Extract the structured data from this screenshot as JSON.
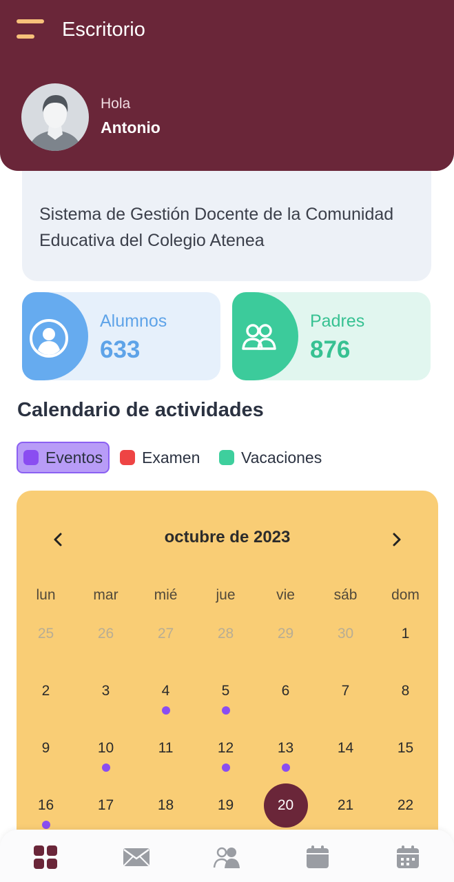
{
  "header": {
    "title": "Escritorio",
    "greeting": "Hola",
    "user_name": "Antonio",
    "background_color": "#6a2639",
    "menu_icon": "hamburger-menu-icon"
  },
  "intro": {
    "text": "Sistema de Gestión Docente de la Comunidad Educativa del Colegio Atenea"
  },
  "stats": [
    {
      "label": "Alumnos",
      "value": "633",
      "icon": "user-circle-icon",
      "color": "#66abef"
    },
    {
      "label": "Padres",
      "value": "876",
      "icon": "users-icon",
      "color": "#3ccb9b"
    }
  ],
  "calendar_section": {
    "title": "Calendario de actividades",
    "legend": [
      {
        "label": "Eventos",
        "color": "#8a4df1",
        "active": true
      },
      {
        "label": "Examen",
        "color": "#ee4444",
        "active": false
      },
      {
        "label": "Vacaciones",
        "color": "#3ecf9d",
        "active": false
      }
    ]
  },
  "calendar": {
    "month_label": "octubre de 2023",
    "background_color": "#f9cd75",
    "weekdays": [
      "lun",
      "mar",
      "mié",
      "jue",
      "vie",
      "sáb",
      "dom"
    ],
    "weeks": [
      [
        {
          "d": "25",
          "other": true
        },
        {
          "d": "26",
          "other": true
        },
        {
          "d": "27",
          "other": true
        },
        {
          "d": "28",
          "other": true
        },
        {
          "d": "29",
          "other": true
        },
        {
          "d": "30",
          "other": true
        },
        {
          "d": "1"
        }
      ],
      [
        {
          "d": "2"
        },
        {
          "d": "3"
        },
        {
          "d": "4",
          "event": true
        },
        {
          "d": "5",
          "event": true
        },
        {
          "d": "6"
        },
        {
          "d": "7"
        },
        {
          "d": "8"
        }
      ],
      [
        {
          "d": "9"
        },
        {
          "d": "10",
          "event": true
        },
        {
          "d": "11"
        },
        {
          "d": "12",
          "event": true
        },
        {
          "d": "13",
          "event": true
        },
        {
          "d": "14"
        },
        {
          "d": "15"
        }
      ],
      [
        {
          "d": "16",
          "event": true
        },
        {
          "d": "17"
        },
        {
          "d": "18"
        },
        {
          "d": "19"
        },
        {
          "d": "20",
          "today": true
        },
        {
          "d": "21"
        },
        {
          "d": "22"
        }
      ]
    ]
  },
  "bottom_nav": [
    {
      "icon": "dashboard-grid-icon",
      "active": true
    },
    {
      "icon": "mail-icon",
      "active": false
    },
    {
      "icon": "users-icon",
      "active": false
    },
    {
      "icon": "calendar-icon",
      "active": false
    },
    {
      "icon": "calendar-events-icon",
      "active": false
    }
  ]
}
